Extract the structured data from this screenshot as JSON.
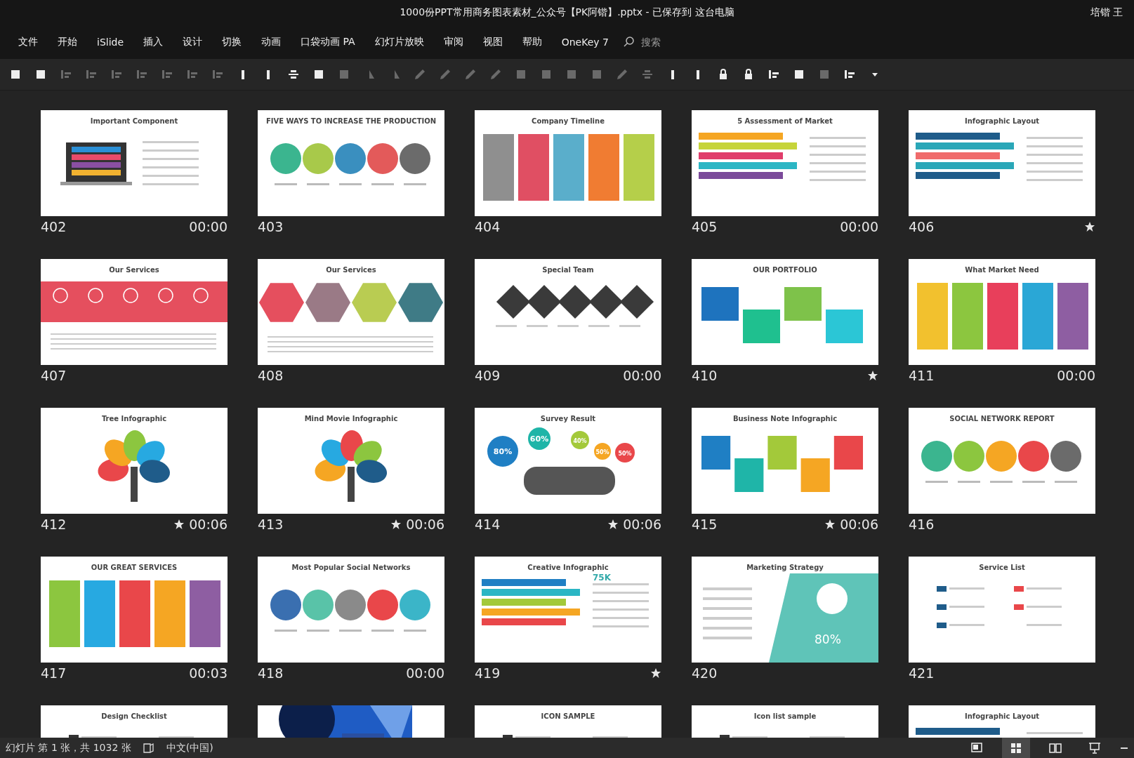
{
  "window": {
    "title": "1000份PPT常用商务图表素材_公众号【PK阿锴】.pptx  -  已保存到 这台电脑",
    "user": "培锴 王"
  },
  "menu": [
    {
      "label": "文件"
    },
    {
      "label": "开始"
    },
    {
      "label": "iSlide"
    },
    {
      "label": "插入"
    },
    {
      "label": "设计"
    },
    {
      "label": "切换"
    },
    {
      "label": "动画"
    },
    {
      "label": "口袋动画 PA"
    },
    {
      "label": "幻灯片放映"
    },
    {
      "label": "审阅"
    },
    {
      "label": "视图"
    },
    {
      "label": "帮助"
    },
    {
      "label": "OneKey 7"
    }
  ],
  "search": {
    "placeholder": "搜索"
  },
  "slides": [
    {
      "number": "402",
      "title": "Important Component",
      "kind": "laptop",
      "time": "00:00",
      "starred": false
    },
    {
      "number": "403",
      "title": "FIVE WAYS TO INCREASE THE PRODUCTION",
      "kind": "circles",
      "starred": false
    },
    {
      "number": "404",
      "title": "Company Timeline",
      "kind": "columns",
      "starred": false
    },
    {
      "number": "405",
      "title": "5 Assessment of Market",
      "kind": "stripes",
      "time": "00:00",
      "starred": false
    },
    {
      "number": "406",
      "title": "Infographic Layout",
      "kind": "stripes",
      "starred": true
    },
    {
      "number": "407",
      "title": "Our Services",
      "kind": "band",
      "starred": false
    },
    {
      "number": "408",
      "title": "Our Services",
      "kind": "hexes",
      "starred": false
    },
    {
      "number": "409",
      "title": "Special Team",
      "kind": "diamonds",
      "time": "00:00",
      "starred": false
    },
    {
      "number": "410",
      "title": "OUR PORTFOLIO",
      "kind": "tiles",
      "starred": true
    },
    {
      "number": "411",
      "title": "What Market Need",
      "kind": "columns",
      "time": "00:00",
      "starred": false
    },
    {
      "number": "412",
      "title": "Tree Infographic",
      "kind": "fan",
      "time": "00:06",
      "starred": true
    },
    {
      "number": "413",
      "title": "Mind Movie Infographic",
      "kind": "fan",
      "time": "00:06",
      "starred": true
    },
    {
      "number": "414",
      "title": "Survey Result",
      "kind": "bubbles",
      "time": "00:06",
      "starred": true,
      "labels": [
        "80%",
        "60%",
        "40%",
        "50%",
        "50%"
      ]
    },
    {
      "number": "415",
      "title": "Business Note Infographic",
      "kind": "tiles",
      "time": "00:06",
      "starred": true
    },
    {
      "number": "416",
      "title": "SOCIAL NETWORK REPORT",
      "kind": "circles",
      "starred": false
    },
    {
      "number": "417",
      "title": "OUR GREAT SERVICES",
      "kind": "columns",
      "time": "00:03",
      "starred": false
    },
    {
      "number": "418",
      "title": "Most Popular Social Networks",
      "kind": "circles",
      "time": "00:00",
      "starred": false
    },
    {
      "number": "419",
      "title": "Creative Infographic",
      "kind": "stripes",
      "starred": true,
      "labels": [
        "75K"
      ]
    },
    {
      "number": "420",
      "title": "Marketing Strategy",
      "kind": "panel",
      "starred": false,
      "labels": [
        "80%"
      ]
    },
    {
      "number": "421",
      "title": "Service List",
      "kind": "list",
      "starred": false
    },
    {
      "title": "Design Checklist",
      "kind": "list"
    },
    {
      "kind": "picture"
    },
    {
      "title": "ICON SAMPLE",
      "kind": "list"
    },
    {
      "title": "Icon list sample",
      "kind": "list"
    },
    {
      "title": "Infographic Layout",
      "kind": "stripes"
    }
  ],
  "status": {
    "slide_info": "幻灯片 第 1 张，共 1032 张",
    "language": "中文(中国)",
    "views": [
      {
        "kind": "normal",
        "selected": false
      },
      {
        "kind": "sorter",
        "selected": true
      },
      {
        "kind": "reading",
        "selected": false
      },
      {
        "kind": "show",
        "selected": false
      }
    ]
  }
}
